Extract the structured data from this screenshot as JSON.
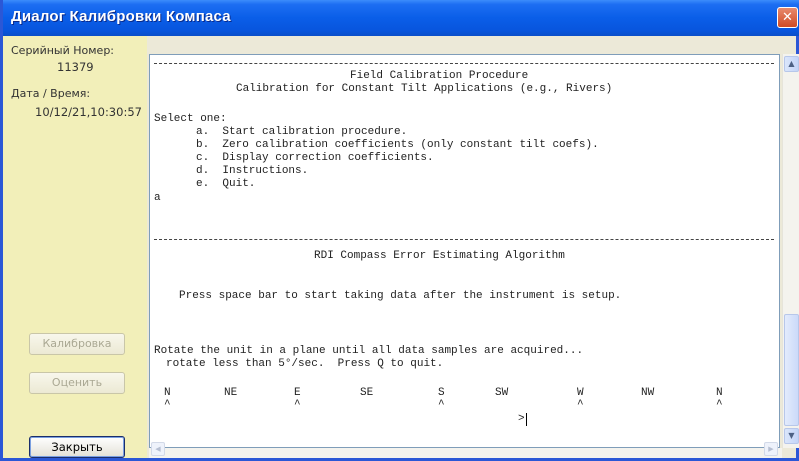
{
  "window": {
    "title": "Диалог Калибровки Компаса",
    "close_glyph": "✕"
  },
  "sidebar": {
    "serial_label": "Серийный Номер:",
    "serial_value": "11379",
    "datetime_label": "Дата / Время:",
    "datetime_value": "10/12/21,10:30:57",
    "calibrate_button": "Калибровка",
    "evaluate_button": "Оценить",
    "close_button": "Закрыть"
  },
  "console": {
    "header_title": "Field Calibration Procedure",
    "header_subtitle": "Calibration for Constant Tilt Applications (e.g., Rivers)",
    "select_prompt": "Select one:",
    "options": [
      "a.  Start calibration procedure.",
      "b.  Zero calibration coefficients (only constant tilt coefs).",
      "c.  Display correction coefficients.",
      "d.  Instructions.",
      "e.  Quit."
    ],
    "user_input": "a",
    "algorithm_title": "RDI Compass Error Estimating Algorithm",
    "press_space": "Press space bar to start taking data after the instrument is setup.",
    "rotate_line1": "Rotate the unit in a plane until all data samples are acquired...",
    "rotate_line2": "rotate less than 5°/sec.  Press Q to quit.",
    "compass_points": [
      "N",
      "NE",
      "E",
      "SE",
      "S",
      "SW",
      "W",
      "NW",
      "N"
    ],
    "compass_marks": [
      "^",
      "",
      "^",
      "",
      "^",
      "",
      "^",
      "",
      "^"
    ],
    "prompt": ">"
  },
  "scrollbars": {
    "up_glyph": "▲",
    "down_glyph": "▼",
    "left_glyph": "◀",
    "right_glyph": "▶"
  }
}
